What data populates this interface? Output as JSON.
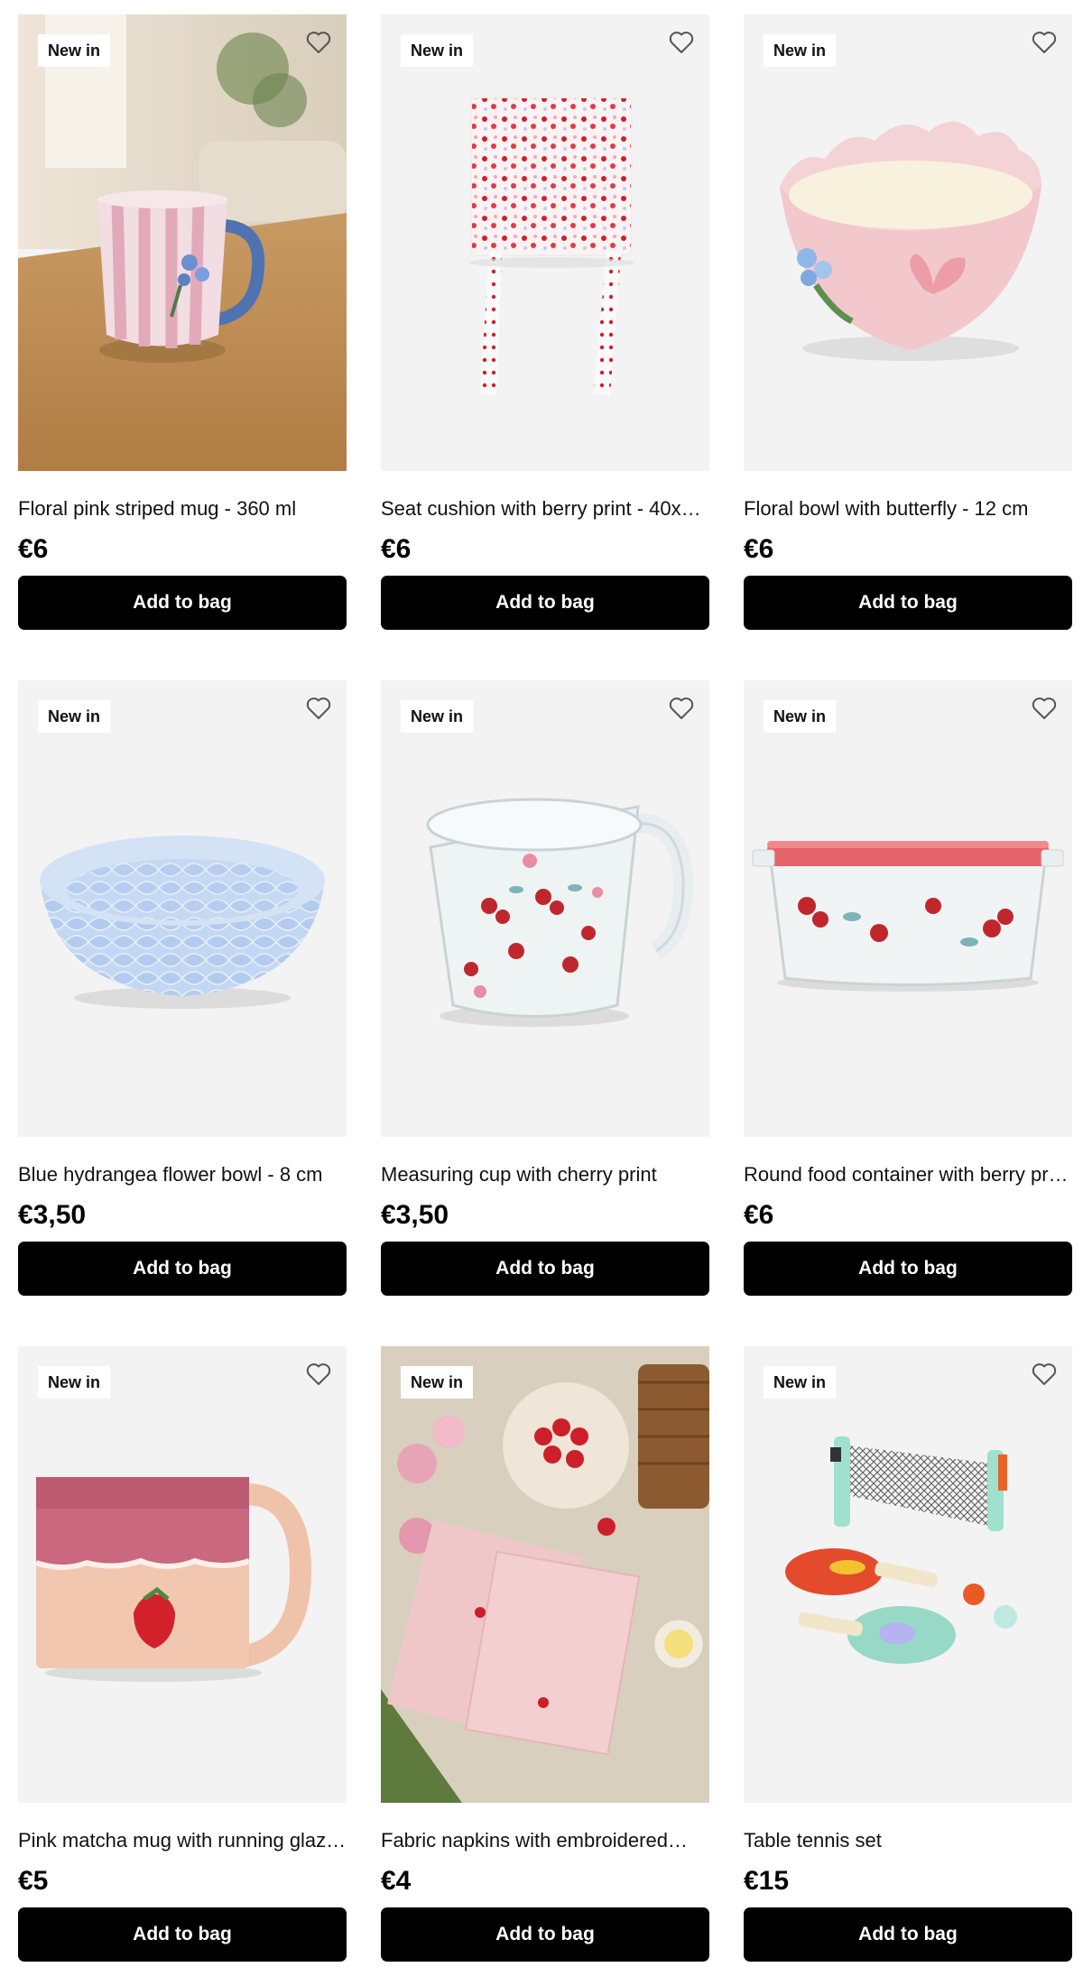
{
  "products": [
    {
      "badge": "New in",
      "title": "Floral pink striped mug - 360 ml",
      "price": "€6",
      "cta": "Add to bag",
      "image": "striped-mug-photo"
    },
    {
      "badge": "New in",
      "title": "Seat cushion with berry print - 40x40…",
      "price": "€6",
      "cta": "Add to bag",
      "image": "seat-cushion-photo"
    },
    {
      "badge": "New in",
      "title": "Floral bowl with butterfly - 12 cm",
      "price": "€6",
      "cta": "Add to bag",
      "image": "pink-bowl-photo"
    },
    {
      "badge": "New in",
      "title": "Blue hydrangea flower bowl - 8 cm",
      "price": "€3,50",
      "cta": "Add to bag",
      "image": "blue-bowl-photo"
    },
    {
      "badge": "New in",
      "title": "Measuring cup with cherry print",
      "price": "€3,50",
      "cta": "Add to bag",
      "image": "measuring-cup-photo"
    },
    {
      "badge": "New in",
      "title": "Round food container with berry prin…",
      "price": "€6",
      "cta": "Add to bag",
      "image": "food-container-photo"
    },
    {
      "badge": "New in",
      "title": "Pink matcha mug with running glaze …",
      "price": "€5",
      "cta": "Add to bag",
      "image": "matcha-mug-photo"
    },
    {
      "badge": "New in",
      "title": "Fabric napkins with embroidered…",
      "price": "€4",
      "cta": "Add to bag",
      "image": "napkins-photo"
    },
    {
      "badge": "New in",
      "title": "Table tennis set",
      "price": "€15",
      "cta": "Add to bag",
      "image": "table-tennis-photo"
    }
  ],
  "colors": {
    "button_bg": "#000000",
    "button_text": "#ffffff",
    "tile_bg": "#f3f3f3"
  },
  "icons": {
    "favorite": "heart-outline-icon"
  }
}
